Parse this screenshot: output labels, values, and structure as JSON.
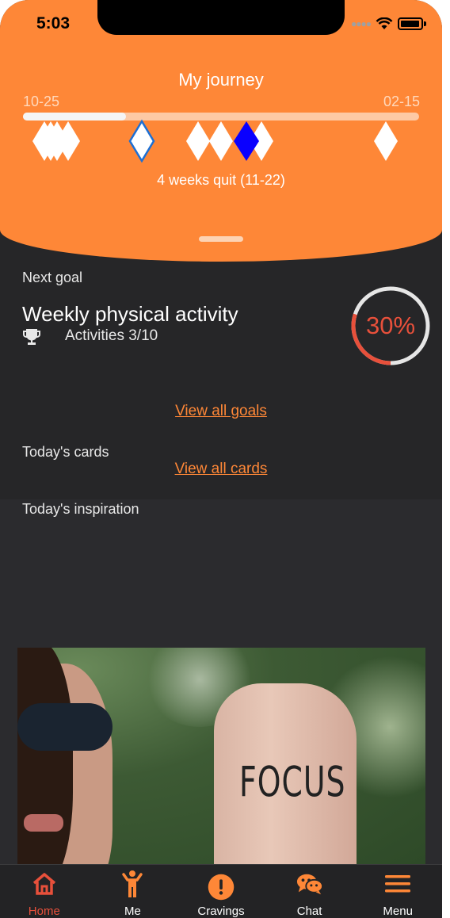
{
  "status_bar": {
    "time": "5:03"
  },
  "journey": {
    "title": "My journey",
    "start_date": "10-25",
    "end_date": "02-15",
    "progress": 0.26,
    "status": "4 weeks quit (11-22)"
  },
  "next_goal": {
    "label": "Next goal",
    "title": "Weekly physical activity",
    "subtitle": "Activities 3/10",
    "percent_text": "30%",
    "percent": 0.3,
    "view_all": "View all goals"
  },
  "cards": {
    "label": "Today's cards",
    "view_all": "View all cards"
  },
  "inspiration": {
    "label": "Today's inspiration",
    "image_text": "FOCUS"
  },
  "tabs": [
    {
      "label": "Home",
      "icon": "home-icon",
      "active": true
    },
    {
      "label": "Me",
      "icon": "person-icon",
      "active": false
    },
    {
      "label": "Cravings",
      "icon": "alert-icon",
      "active": false
    },
    {
      "label": "Chat",
      "icon": "chat-icon",
      "active": false
    },
    {
      "label": "Menu",
      "icon": "menu-icon",
      "active": false
    }
  ],
  "colors": {
    "accent": "#FE8737",
    "active_tab": "#e8503b",
    "background": "#262628"
  }
}
